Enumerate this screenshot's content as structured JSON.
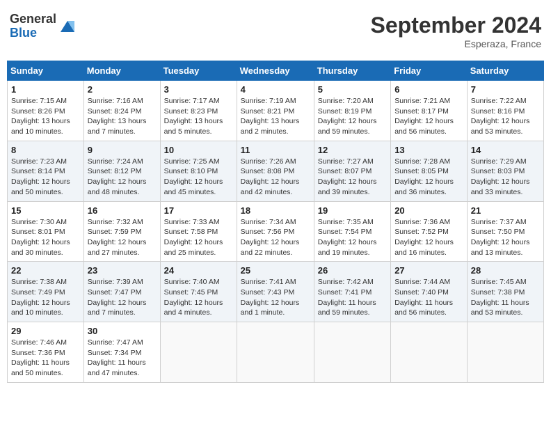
{
  "header": {
    "logo": {
      "line1": "General",
      "line2": "Blue"
    },
    "title": "September 2024",
    "location": "Esperaza, France"
  },
  "weekdays": [
    "Sunday",
    "Monday",
    "Tuesday",
    "Wednesday",
    "Thursday",
    "Friday",
    "Saturday"
  ],
  "weeks": [
    [
      {
        "day": 1,
        "info": "Sunrise: 7:15 AM\nSunset: 8:26 PM\nDaylight: 13 hours\nand 10 minutes."
      },
      {
        "day": 2,
        "info": "Sunrise: 7:16 AM\nSunset: 8:24 PM\nDaylight: 13 hours\nand 7 minutes."
      },
      {
        "day": 3,
        "info": "Sunrise: 7:17 AM\nSunset: 8:23 PM\nDaylight: 13 hours\nand 5 minutes."
      },
      {
        "day": 4,
        "info": "Sunrise: 7:19 AM\nSunset: 8:21 PM\nDaylight: 13 hours\nand 2 minutes."
      },
      {
        "day": 5,
        "info": "Sunrise: 7:20 AM\nSunset: 8:19 PM\nDaylight: 12 hours\nand 59 minutes."
      },
      {
        "day": 6,
        "info": "Sunrise: 7:21 AM\nSunset: 8:17 PM\nDaylight: 12 hours\nand 56 minutes."
      },
      {
        "day": 7,
        "info": "Sunrise: 7:22 AM\nSunset: 8:16 PM\nDaylight: 12 hours\nand 53 minutes."
      }
    ],
    [
      {
        "day": 8,
        "info": "Sunrise: 7:23 AM\nSunset: 8:14 PM\nDaylight: 12 hours\nand 50 minutes."
      },
      {
        "day": 9,
        "info": "Sunrise: 7:24 AM\nSunset: 8:12 PM\nDaylight: 12 hours\nand 48 minutes."
      },
      {
        "day": 10,
        "info": "Sunrise: 7:25 AM\nSunset: 8:10 PM\nDaylight: 12 hours\nand 45 minutes."
      },
      {
        "day": 11,
        "info": "Sunrise: 7:26 AM\nSunset: 8:08 PM\nDaylight: 12 hours\nand 42 minutes."
      },
      {
        "day": 12,
        "info": "Sunrise: 7:27 AM\nSunset: 8:07 PM\nDaylight: 12 hours\nand 39 minutes."
      },
      {
        "day": 13,
        "info": "Sunrise: 7:28 AM\nSunset: 8:05 PM\nDaylight: 12 hours\nand 36 minutes."
      },
      {
        "day": 14,
        "info": "Sunrise: 7:29 AM\nSunset: 8:03 PM\nDaylight: 12 hours\nand 33 minutes."
      }
    ],
    [
      {
        "day": 15,
        "info": "Sunrise: 7:30 AM\nSunset: 8:01 PM\nDaylight: 12 hours\nand 30 minutes."
      },
      {
        "day": 16,
        "info": "Sunrise: 7:32 AM\nSunset: 7:59 PM\nDaylight: 12 hours\nand 27 minutes."
      },
      {
        "day": 17,
        "info": "Sunrise: 7:33 AM\nSunset: 7:58 PM\nDaylight: 12 hours\nand 25 minutes."
      },
      {
        "day": 18,
        "info": "Sunrise: 7:34 AM\nSunset: 7:56 PM\nDaylight: 12 hours\nand 22 minutes."
      },
      {
        "day": 19,
        "info": "Sunrise: 7:35 AM\nSunset: 7:54 PM\nDaylight: 12 hours\nand 19 minutes."
      },
      {
        "day": 20,
        "info": "Sunrise: 7:36 AM\nSunset: 7:52 PM\nDaylight: 12 hours\nand 16 minutes."
      },
      {
        "day": 21,
        "info": "Sunrise: 7:37 AM\nSunset: 7:50 PM\nDaylight: 12 hours\nand 13 minutes."
      }
    ],
    [
      {
        "day": 22,
        "info": "Sunrise: 7:38 AM\nSunset: 7:49 PM\nDaylight: 12 hours\nand 10 minutes."
      },
      {
        "day": 23,
        "info": "Sunrise: 7:39 AM\nSunset: 7:47 PM\nDaylight: 12 hours\nand 7 minutes."
      },
      {
        "day": 24,
        "info": "Sunrise: 7:40 AM\nSunset: 7:45 PM\nDaylight: 12 hours\nand 4 minutes."
      },
      {
        "day": 25,
        "info": "Sunrise: 7:41 AM\nSunset: 7:43 PM\nDaylight: 12 hours\nand 1 minute."
      },
      {
        "day": 26,
        "info": "Sunrise: 7:42 AM\nSunset: 7:41 PM\nDaylight: 11 hours\nand 59 minutes."
      },
      {
        "day": 27,
        "info": "Sunrise: 7:44 AM\nSunset: 7:40 PM\nDaylight: 11 hours\nand 56 minutes."
      },
      {
        "day": 28,
        "info": "Sunrise: 7:45 AM\nSunset: 7:38 PM\nDaylight: 11 hours\nand 53 minutes."
      }
    ],
    [
      {
        "day": 29,
        "info": "Sunrise: 7:46 AM\nSunset: 7:36 PM\nDaylight: 11 hours\nand 50 minutes."
      },
      {
        "day": 30,
        "info": "Sunrise: 7:47 AM\nSunset: 7:34 PM\nDaylight: 11 hours\nand 47 minutes."
      },
      null,
      null,
      null,
      null,
      null
    ]
  ]
}
